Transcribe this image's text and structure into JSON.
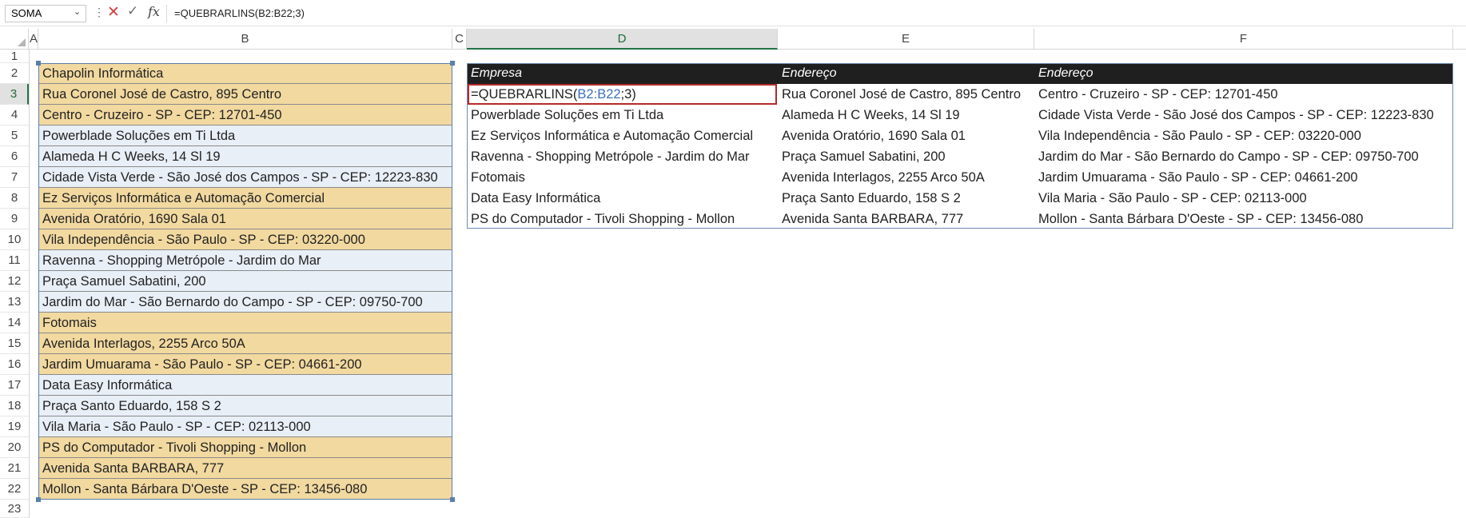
{
  "formula_bar": {
    "name_box": "SOMA",
    "more_glyph": "⋮",
    "cancel_glyph": "✕",
    "enter_glyph": "✓",
    "fx_label": "fx",
    "formula": "=QUEBRARLINS(B2:B22;3)"
  },
  "columns": [
    "A",
    "B",
    "C",
    "D",
    "E",
    "F"
  ],
  "rows": [
    "1",
    "2",
    "3",
    "4",
    "5",
    "6",
    "7",
    "8",
    "9",
    "10",
    "11",
    "12",
    "13",
    "14",
    "15",
    "16",
    "17",
    "18",
    "19",
    "20",
    "21",
    "22",
    "23"
  ],
  "column_b": [
    "Chapolin Informática",
    "Rua Coronel José de Castro, 895 Centro",
    "Centro - Cruzeiro - SP - CEP: 12701-450",
    "Powerblade Soluções em Ti Ltda",
    "Alameda H C Weeks, 14 Sl 19",
    "Cidade Vista Verde - São José dos Campos - SP - CEP: 12223-830",
    "Ez Serviços Informática e Automação Comercial",
    "Avenida Oratório, 1690 Sala 01",
    "Vila Independência - São Paulo - SP - CEP: 03220-000",
    "Ravenna - Shopping Metrópole - Jardim do Mar",
    "Praça Samuel Sabatini, 200",
    "Jardim do Mar - São Bernardo do Campo - SP - CEP: 09750-700",
    "Fotomais",
    "Avenida Interlagos, 2255 Arco 50A",
    "Jardim Umuarama - São Paulo - SP - CEP: 04661-200",
    "Data Easy Informática",
    "Praça Santo Eduardo, 158 S 2",
    "Vila Maria - São Paulo - SP - CEP: 02113-000",
    "PS do Computador - Tivoli Shopping - Mollon",
    "Avenida Santa BARBARA, 777",
    "Mollon - Santa Bárbara D'Oeste - SP - CEP: 13456-080"
  ],
  "table": {
    "headers": [
      "Empresa",
      "Endereço",
      "Endereço"
    ],
    "active_formula": {
      "prefix": "=QUEBRARLINS(",
      "ref": "B2:B22",
      "suffix": ";3)"
    },
    "rows": [
      [
        "",
        "Rua Coronel José de Castro, 895 Centro",
        "Centro - Cruzeiro - SP - CEP: 12701-450"
      ],
      [
        "Powerblade Soluções em Ti Ltda",
        "Alameda H C Weeks, 14 Sl 19",
        "Cidade Vista Verde - São José dos Campos - SP - CEP: 12223-830"
      ],
      [
        "Ez Serviços Informática e Automação Comercial",
        "Avenida Oratório, 1690 Sala 01",
        "Vila Independência - São Paulo - SP - CEP: 03220-000"
      ],
      [
        "Ravenna - Shopping Metrópole - Jardim do Mar",
        "Praça Samuel Sabatini, 200",
        "Jardim do Mar - São Bernardo do Campo - SP - CEP: 09750-700"
      ],
      [
        "Fotomais",
        "Avenida Interlagos, 2255 Arco 50A",
        "Jardim Umuarama - São Paulo - SP - CEP: 04661-200"
      ],
      [
        "Data Easy Informática",
        "Praça Santo Eduardo, 158 S 2",
        "Vila Maria - São Paulo - SP - CEP: 02113-000"
      ],
      [
        "PS do Computador - Tivoli Shopping - Mollon",
        "Avenida Santa BARBARA, 777",
        "Mollon - Santa Bárbara D'Oeste - SP - CEP: 13456-080"
      ]
    ]
  },
  "colors": {
    "group_fill": "#f2d9a0",
    "alt_fill": "#e9eff7",
    "active_border": "#b52a2a",
    "table_header": "#1f1f1f"
  }
}
